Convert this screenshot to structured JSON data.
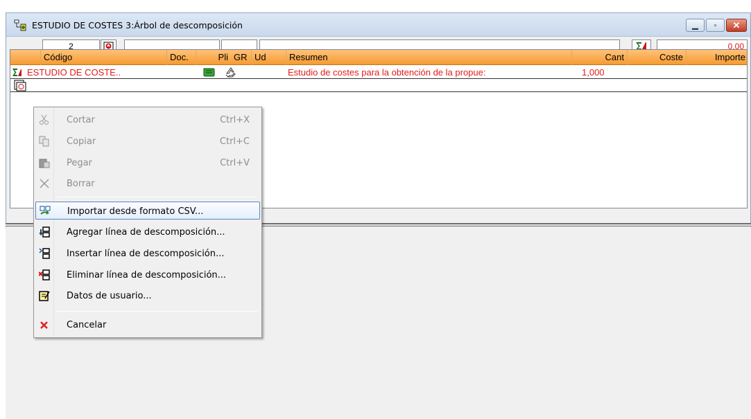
{
  "window": {
    "title": "ESTUDIO DE COSTES 3:Árbol de descomposición",
    "buttons": [
      "minimize-button",
      "maximize-button",
      "close-button"
    ]
  },
  "toolbar": {
    "level_value": "2",
    "total_value": "0,00"
  },
  "grid": {
    "columns": [
      "Código",
      "Doc.",
      "Pli",
      "GR",
      "Ud",
      "Resumen",
      "Cant",
      "Coste",
      "Importe"
    ],
    "rows": [
      {
        "codigo": "ESTUDIO DE COSTE..",
        "resumen": "Estudio de costes para la obtención de la propue:",
        "cant": "1,000"
      }
    ]
  },
  "context_menu": {
    "items": [
      {
        "label": "Cortar",
        "shortcut": "Ctrl+X",
        "icon": "scissors-icon",
        "enabled": false
      },
      {
        "label": "Copiar",
        "shortcut": "Ctrl+C",
        "icon": "copy-icon",
        "enabled": false
      },
      {
        "label": "Pegar",
        "shortcut": "Ctrl+V",
        "icon": "paste-icon",
        "enabled": false
      },
      {
        "label": "Borrar",
        "shortcut": "",
        "icon": "delete-x-icon",
        "enabled": false
      },
      {
        "label": "Importar desde formato CSV...",
        "shortcut": "",
        "icon": "import-csv-icon",
        "enabled": true
      },
      {
        "label": "Agregar línea de descomposición...",
        "shortcut": "",
        "icon": "add-line-icon",
        "enabled": true
      },
      {
        "label": "Insertar línea de descomposición...",
        "shortcut": "",
        "icon": "insert-line-icon",
        "enabled": true
      },
      {
        "label": "Eliminar línea de descomposición...",
        "shortcut": "",
        "icon": "remove-line-icon",
        "enabled": true
      },
      {
        "label": "Datos de usuario...",
        "shortcut": "",
        "icon": "user-data-icon",
        "enabled": true
      },
      {
        "label": "Cancelar",
        "shortcut": "",
        "icon": "cancel-icon",
        "enabled": true
      }
    ]
  },
  "colors": {
    "header_orange": "#f59b31",
    "row_text_red": "#e11b1b",
    "menu_highlight_border": "#5a84c4"
  }
}
